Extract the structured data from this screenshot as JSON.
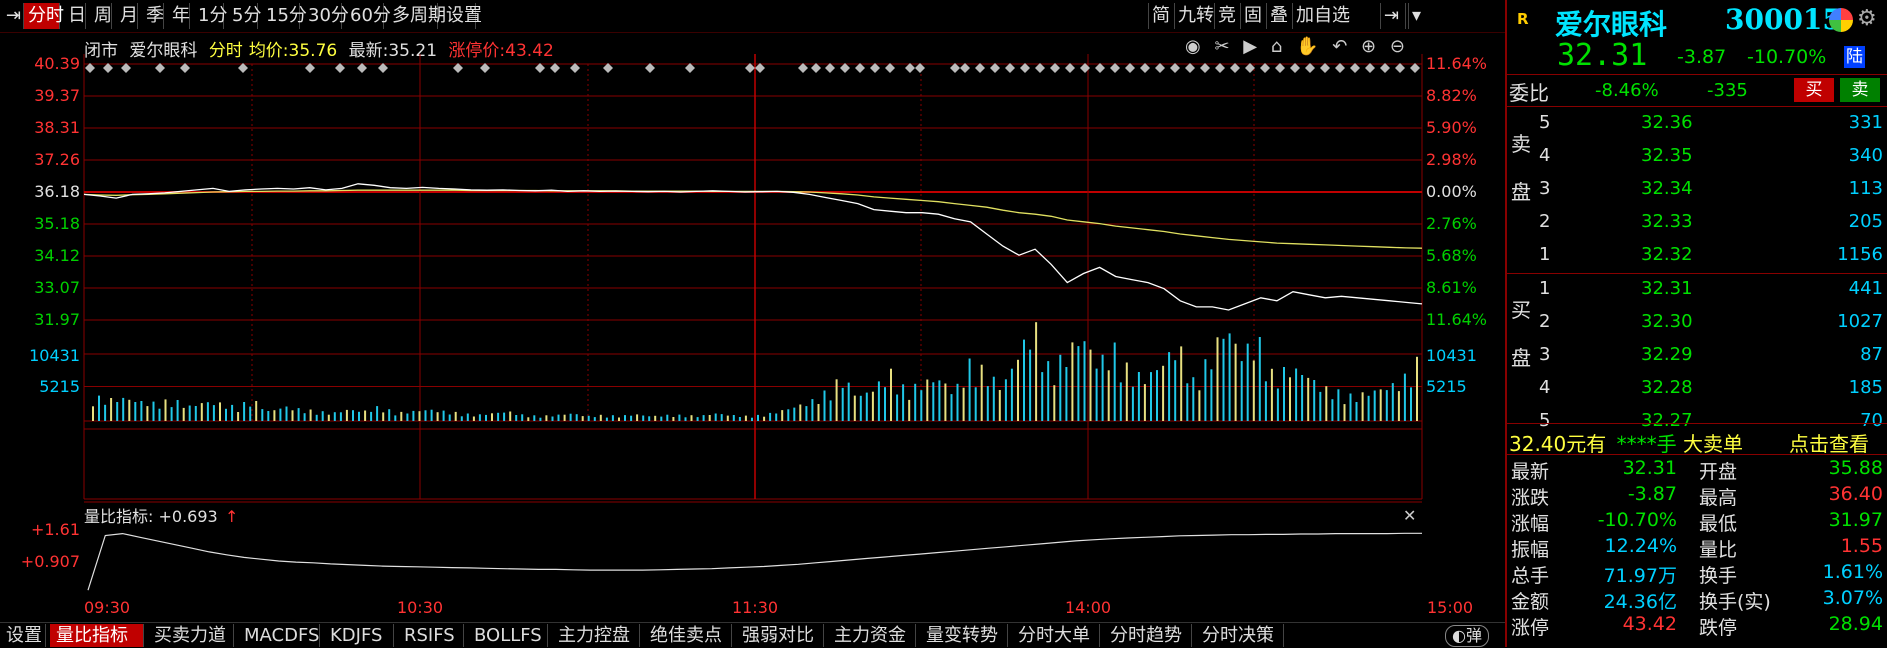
{
  "toolbar": {
    "items": [
      "分时",
      "日",
      "周",
      "月",
      "季",
      "年",
      "1分",
      "5分",
      "15分",
      "30分",
      "60分",
      "多周期",
      "设置"
    ],
    "right_items": [
      "简",
      "九转",
      "竞",
      "固",
      "叠",
      "加自选"
    ]
  },
  "info": {
    "status": "闭市",
    "name": "爱尔眼科",
    "mode": "分时",
    "avg_label": "均价:",
    "avg_value": "35.76",
    "latest_label": "最新:",
    "latest_value": "35.21",
    "limit_label": "涨停价:",
    "limit_value": "43.42"
  },
  "chart_data": {
    "type": "line",
    "y_left_labels": [
      "40.39",
      "39.37",
      "38.31",
      "37.26",
      "36.18",
      "35.18",
      "34.12",
      "33.07",
      "31.97"
    ],
    "y_right_labels": [
      "11.64%",
      "8.82%",
      "5.90%",
      "2.98%",
      "0.00%",
      "2.76%",
      "5.68%",
      "8.61%",
      "11.64%"
    ],
    "vol_labels": [
      "10431",
      "5215"
    ],
    "x_labels": [
      "09:30",
      "10:30",
      "11:30",
      "14:00",
      "15:00"
    ],
    "ylim": [
      31.97,
      40.39
    ],
    "prev_close": 36.18,
    "price": [
      36.1,
      36.05,
      35.98,
      36.1,
      36.12,
      36.15,
      36.2,
      36.25,
      36.3,
      36.2,
      36.25,
      36.28,
      36.3,
      36.28,
      36.32,
      36.25,
      36.3,
      36.45,
      36.4,
      36.32,
      36.3,
      36.33,
      36.3,
      36.28,
      36.25,
      36.24,
      36.25,
      36.23,
      36.22,
      36.24,
      36.2,
      36.22,
      36.2,
      36.21,
      36.2,
      36.19,
      36.2,
      36.18,
      36.2,
      36.22,
      36.2,
      36.18,
      36.19,
      36.2,
      36.17,
      36.1,
      36.0,
      35.9,
      35.8,
      35.6,
      35.55,
      35.5,
      35.5,
      35.45,
      35.3,
      35.2,
      34.8,
      34.4,
      34.1,
      34.3,
      33.8,
      33.2,
      33.5,
      33.7,
      33.4,
      33.3,
      33.2,
      33.0,
      32.6,
      32.4,
      32.4,
      32.3,
      32.5,
      32.7,
      32.6,
      32.9,
      32.8,
      32.7,
      32.75,
      32.7,
      32.65,
      32.6,
      32.55,
      32.5
    ],
    "avg": [
      36.1,
      36.08,
      36.07,
      36.09,
      36.1,
      36.12,
      36.14,
      36.16,
      36.18,
      36.19,
      36.2,
      36.2,
      36.21,
      36.21,
      36.22,
      36.22,
      36.23,
      36.24,
      36.24,
      36.24,
      36.24,
      36.24,
      36.24,
      36.24,
      36.23,
      36.23,
      36.23,
      36.23,
      36.23,
      36.22,
      36.22,
      36.22,
      36.22,
      36.22,
      36.21,
      36.21,
      36.21,
      36.21,
      36.21,
      36.2,
      36.2,
      36.2,
      36.2,
      36.2,
      36.19,
      36.18,
      36.15,
      36.12,
      36.08,
      36.02,
      35.98,
      35.94,
      35.9,
      35.86,
      35.8,
      35.74,
      35.68,
      35.58,
      35.5,
      35.45,
      35.38,
      35.26,
      35.2,
      35.14,
      35.06,
      35.0,
      34.94,
      34.88,
      34.8,
      34.74,
      34.68,
      34.62,
      34.58,
      34.54,
      34.5,
      34.48,
      34.46,
      34.44,
      34.42,
      34.4,
      34.38,
      34.36,
      34.34,
      34.33
    ],
    "volume": [
      0.25,
      0.22,
      0.24,
      0.2,
      0.18,
      0.22,
      0.15,
      0.2,
      0.18,
      0.14,
      0.22,
      0.1,
      0.15,
      0.12,
      0.1,
      0.08,
      0.12,
      0.1,
      0.15,
      0.08,
      0.1,
      0.12,
      0.1,
      0.08,
      0.06,
      0.08,
      0.1,
      0.06,
      0.05,
      0.06,
      0.08,
      0.05,
      0.06,
      0.05,
      0.07,
      0.05,
      0.06,
      0.06,
      0.05,
      0.08,
      0.06,
      0.05,
      0.06,
      0.1,
      0.15,
      0.2,
      0.3,
      0.45,
      0.25,
      0.35,
      0.5,
      0.3,
      0.4,
      0.45,
      0.3,
      0.6,
      0.5,
      0.35,
      0.7,
      1.0,
      0.5,
      0.7,
      0.9,
      0.6,
      0.75,
      0.5,
      0.45,
      0.6,
      0.8,
      0.4,
      0.65,
      1.0,
      0.7,
      0.85,
      0.45,
      0.55,
      0.5,
      0.35,
      0.3,
      0.25,
      0.3,
      0.35,
      0.4,
      0.6
    ],
    "ratio": [
      0.05,
      1.55,
      1.6,
      1.5,
      1.4,
      1.3,
      1.2,
      1.1,
      1.02,
      0.95,
      0.9,
      0.85,
      0.82,
      0.8,
      0.77,
      0.75,
      0.73,
      0.71,
      0.7,
      0.69,
      0.68,
      0.67,
      0.66,
      0.65,
      0.64,
      0.63,
      0.62,
      0.62,
      0.61,
      0.6,
      0.6,
      0.6,
      0.6,
      0.61,
      0.62,
      0.63,
      0.64,
      0.66,
      0.68,
      0.7,
      0.73,
      0.76,
      0.8,
      0.84,
      0.88,
      0.92,
      0.96,
      1.0,
      1.04,
      1.08,
      1.12,
      1.16,
      1.2,
      1.24,
      1.28,
      1.32,
      1.36,
      1.4,
      1.43,
      1.46,
      1.48,
      1.5,
      1.52,
      1.54,
      1.55,
      1.56,
      1.57,
      1.57,
      1.58,
      1.58,
      1.59,
      1.59,
      1.6,
      1.6,
      1.6,
      1.6,
      1.61,
      1.61
    ],
    "ratio_labels": [
      "+1.61",
      "+0.907"
    ],
    "ratio_title": "量比指标: +0.693"
  },
  "panel": {
    "badge": "R",
    "name": "爱尔眼科",
    "code": "300015",
    "price": "32.31",
    "change": "-3.87",
    "pct": "-10.70%",
    "tag": "陆",
    "weibi_label": "委比",
    "weibi_pct": "-8.46%",
    "weibi_diff": "-335",
    "buy_btn": "买",
    "sell_btn": "卖",
    "sell_label": [
      "卖",
      "盘"
    ],
    "buy_label": [
      "买",
      "盘"
    ],
    "asks": [
      {
        "lvl": "5",
        "price": "32.36",
        "vol": "331"
      },
      {
        "lvl": "4",
        "price": "32.35",
        "vol": "340"
      },
      {
        "lvl": "3",
        "price": "32.34",
        "vol": "113"
      },
      {
        "lvl": "2",
        "price": "32.33",
        "vol": "205"
      },
      {
        "lvl": "1",
        "price": "32.32",
        "vol": "1156"
      }
    ],
    "bids": [
      {
        "lvl": "1",
        "price": "32.31",
        "vol": "441"
      },
      {
        "lvl": "2",
        "price": "32.30",
        "vol": "1027"
      },
      {
        "lvl": "3",
        "price": "32.29",
        "vol": "87"
      },
      {
        "lvl": "4",
        "price": "32.28",
        "vol": "185"
      },
      {
        "lvl": "5",
        "price": "32.27",
        "vol": "70"
      }
    ],
    "bigorder": {
      "price": "32.40",
      "unit": "元有",
      "hands": "****手",
      "type": "大卖单",
      "link": "点击查看"
    },
    "stats": [
      {
        "l1": "最新",
        "v1": "32.31",
        "c1": "green",
        "l2": "开盘",
        "v2": "35.88",
        "c2": "green"
      },
      {
        "l1": "涨跌",
        "v1": "-3.87",
        "c1": "green",
        "l2": "最高",
        "v2": "36.40",
        "c2": "red"
      },
      {
        "l1": "涨幅",
        "v1": "-10.70%",
        "c1": "green",
        "l2": "最低",
        "v2": "31.97",
        "c2": "green"
      },
      {
        "l1": "振幅",
        "v1": "12.24%",
        "c1": "cyan",
        "l2": "量比",
        "v2": "1.55",
        "c2": "red"
      },
      {
        "l1": "总手",
        "v1": "71.97万",
        "c1": "cyan",
        "l2": "换手",
        "v2": "1.61%",
        "c2": "cyan"
      },
      {
        "l1": "金额",
        "v1": "24.36亿",
        "c1": "cyan",
        "l2": "换手(实)",
        "v2": "3.07%",
        "c2": "cyan"
      },
      {
        "l1": "涨停",
        "v1": "43.42",
        "c1": "red",
        "l2": "跌停",
        "v2": "28.94",
        "c2": "green"
      }
    ]
  },
  "bottom": {
    "tabs": [
      "设置",
      "量比指标",
      "买卖力道",
      "MACDFS",
      "KDJFS",
      "RSIFS",
      "BOLLFS",
      "主力控盘",
      "绝佳卖点",
      "强弱对比",
      "主力资金",
      "量变转势",
      "分时大单",
      "分时趋势",
      "分时决策"
    ],
    "toggle": "弹"
  }
}
